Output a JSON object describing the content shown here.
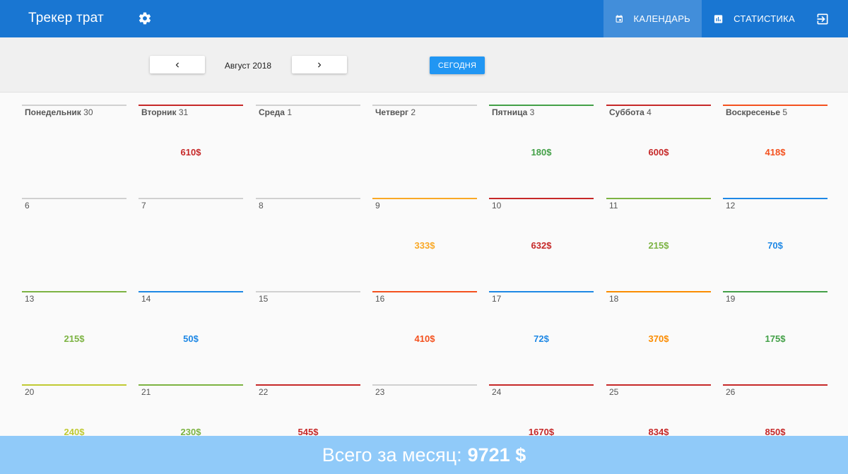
{
  "app": {
    "title": "Трекер трат",
    "settings_icon": "gear-icon",
    "nav": [
      {
        "label": "Календарь",
        "icon": "calendar-icon",
        "active": true
      },
      {
        "label": "Статистика",
        "icon": "bar-chart-icon",
        "active": false
      },
      {
        "label": "",
        "icon": "exit-icon",
        "active": false
      }
    ],
    "accent": "#1976d2"
  },
  "toolbar": {
    "month": "Август 2018",
    "today_label": "Сегодня",
    "prev_icon": "chevron-left-icon",
    "next_icon": "chevron-right-icon"
  },
  "calendar": {
    "weeks": [
      [
        {
          "dayname": "Понедельник",
          "day": "30",
          "amount": "",
          "color": "#d0d0d0"
        },
        {
          "dayname": "Вторник",
          "day": "31",
          "amount": "610$",
          "color": "#c62828"
        },
        {
          "dayname": "Среда",
          "day": "1",
          "amount": "",
          "color": "#d0d0d0"
        },
        {
          "dayname": "Четверг",
          "day": "2",
          "amount": "",
          "color": "#d0d0d0"
        },
        {
          "dayname": "Пятница",
          "day": "3",
          "amount": "180$",
          "color": "#43a047"
        },
        {
          "dayname": "Суббота",
          "day": "4",
          "amount": "600$",
          "color": "#c62828"
        },
        {
          "dayname": "Воскресенье",
          "day": "5",
          "amount": "418$",
          "color": "#f4511e"
        }
      ],
      [
        {
          "dayname": "",
          "day": "6",
          "amount": "",
          "color": "#d0d0d0"
        },
        {
          "dayname": "",
          "day": "7",
          "amount": "",
          "color": "#d0d0d0"
        },
        {
          "dayname": "",
          "day": "8",
          "amount": "",
          "color": "#d0d0d0"
        },
        {
          "dayname": "",
          "day": "9",
          "amount": "333$",
          "color": "#f9a825"
        },
        {
          "dayname": "",
          "day": "10",
          "amount": "632$",
          "color": "#c62828"
        },
        {
          "dayname": "",
          "day": "11",
          "amount": "215$",
          "color": "#7cb342"
        },
        {
          "dayname": "",
          "day": "12",
          "amount": "70$",
          "color": "#1e88e5"
        }
      ],
      [
        {
          "dayname": "",
          "day": "13",
          "amount": "215$",
          "color": "#7cb342"
        },
        {
          "dayname": "",
          "day": "14",
          "amount": "50$",
          "color": "#1e88e5"
        },
        {
          "dayname": "",
          "day": "15",
          "amount": "",
          "color": "#d0d0d0"
        },
        {
          "dayname": "",
          "day": "16",
          "amount": "410$",
          "color": "#f4511e"
        },
        {
          "dayname": "",
          "day": "17",
          "amount": "72$",
          "color": "#1e88e5"
        },
        {
          "dayname": "",
          "day": "18",
          "amount": "370$",
          "color": "#fb8c00"
        },
        {
          "dayname": "",
          "day": "19",
          "amount": "175$",
          "color": "#43a047"
        }
      ],
      [
        {
          "dayname": "",
          "day": "20",
          "amount": "240$",
          "color": "#c0ca33"
        },
        {
          "dayname": "",
          "day": "21",
          "amount": "230$",
          "color": "#7cb342"
        },
        {
          "dayname": "",
          "day": "22",
          "amount": "545$",
          "color": "#c62828"
        },
        {
          "dayname": "",
          "day": "23",
          "amount": "",
          "color": "#d0d0d0"
        },
        {
          "dayname": "",
          "day": "24",
          "amount": "1670$",
          "color": "#c62828"
        },
        {
          "dayname": "",
          "day": "25",
          "amount": "834$",
          "color": "#c62828"
        },
        {
          "dayname": "",
          "day": "26",
          "amount": "850$",
          "color": "#c62828"
        }
      ]
    ]
  },
  "footer": {
    "label": "Всего за месяц:",
    "total": "9721 $"
  }
}
